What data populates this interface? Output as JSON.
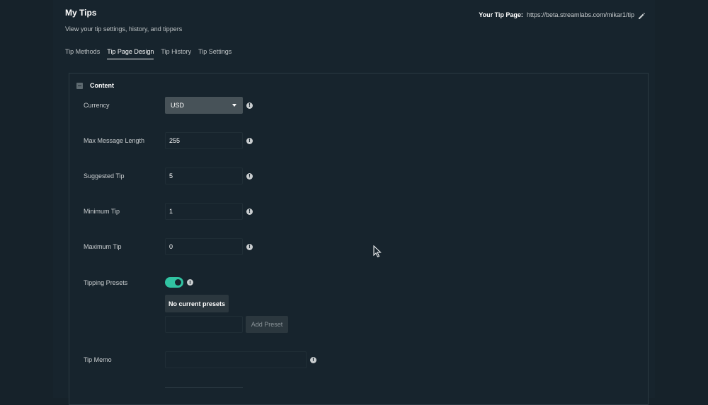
{
  "header": {
    "title": "My Tips",
    "subtitle": "View your tip settings, history, and tippers",
    "tip_page_label": "Your Tip Page:",
    "tip_page_url": "https://beta.streamlabs.com/mikar1/tip",
    "edit_icon": "pencil-icon"
  },
  "tabs": [
    {
      "label": "Tip Methods",
      "active": false
    },
    {
      "label": "Tip Page Design",
      "active": true
    },
    {
      "label": "Tip History",
      "active": false
    },
    {
      "label": "Tip Settings",
      "active": false
    }
  ],
  "content": {
    "section_title": "Content",
    "currency": {
      "label": "Currency",
      "value": "USD"
    },
    "max_message_length": {
      "label": "Max Message Length",
      "value": "255"
    },
    "suggested_tip": {
      "label": "Suggested Tip",
      "value": "5"
    },
    "minimum_tip": {
      "label": "Minimum Tip",
      "value": "1"
    },
    "maximum_tip": {
      "label": "Maximum Tip",
      "value": "0"
    },
    "tipping_presets": {
      "label": "Tipping Presets",
      "enabled": true,
      "empty_text": "No current presets",
      "add_button": "Add Preset"
    },
    "tip_memo": {
      "label": "Tip Memo",
      "value": ""
    }
  },
  "icons": {
    "info": "!",
    "accent_color": "#31c3a2"
  }
}
